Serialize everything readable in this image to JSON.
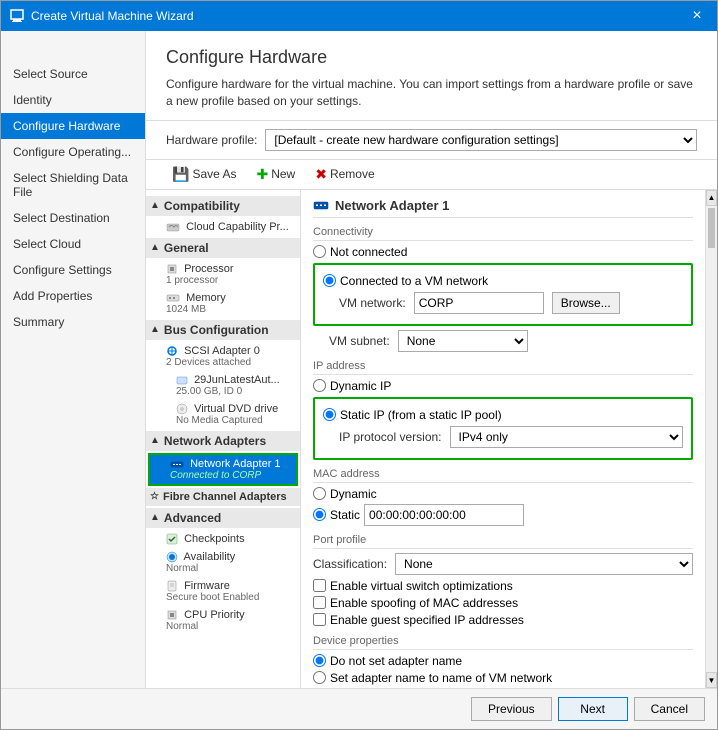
{
  "window": {
    "title": "Create Virtual Machine Wizard",
    "close_icon": "×"
  },
  "left_panel": {
    "header": "Configure Hardware",
    "nav_items": [
      {
        "label": "Select Source",
        "active": false
      },
      {
        "label": "Identity",
        "active": false
      },
      {
        "label": "Configure Hardware",
        "active": true
      },
      {
        "label": "Configure Operating...",
        "active": false
      },
      {
        "label": "Select Shielding Data File",
        "active": false
      },
      {
        "label": "Select Destination",
        "active": false
      },
      {
        "label": "Select Cloud",
        "active": false
      },
      {
        "label": "Configure Settings",
        "active": false
      },
      {
        "label": "Add Properties",
        "active": false
      },
      {
        "label": "Summary",
        "active": false
      }
    ]
  },
  "page": {
    "title": "Configure Hardware",
    "description": "Configure hardware for the virtual machine. You can import settings from a hardware profile or save a new profile based on your settings.",
    "hardware_profile_label": "Hardware profile:",
    "hardware_profile_value": "[Default - create new hardware configuration settings]"
  },
  "toolbar": {
    "save_as": "Save As",
    "new": "New",
    "remove": "Remove"
  },
  "tree": {
    "compatibility": {
      "label": "Compatibility",
      "items": [
        {
          "label": "Cloud Capability Pr...",
          "sub": ""
        }
      ]
    },
    "general": {
      "label": "General",
      "items": [
        {
          "label": "Processor",
          "sub": "1 processor"
        },
        {
          "label": "Memory",
          "sub": "1024 MB"
        }
      ]
    },
    "bus_configuration": {
      "label": "Bus Configuration",
      "items": [
        {
          "label": "SCSI Adapter 0",
          "sub": "2 Devices attached"
        },
        {
          "label": "29JunLatestAut...",
          "sub": "25.00 GB, ID 0"
        },
        {
          "label": "Virtual DVD drive",
          "sub": "No Media Captured"
        }
      ]
    },
    "network_adapters": {
      "label": "Network Adapters",
      "items": [
        {
          "label": "Network Adapter 1",
          "sub": "Connected to CORP",
          "selected": true
        }
      ]
    },
    "fibre_channel": {
      "label": "Fibre Channel Adapters"
    },
    "advanced": {
      "label": "Advanced",
      "items": [
        {
          "label": "Checkpoints",
          "sub": ""
        },
        {
          "label": "Availability",
          "sub": "Normal"
        },
        {
          "label": "Firmware",
          "sub": "Secure boot Enabled"
        },
        {
          "label": "CPU Priority",
          "sub": "Normal"
        }
      ]
    }
  },
  "network_adapter": {
    "title": "Network Adapter 1",
    "connectivity": {
      "section": "Connectivity",
      "not_connected": "Not connected",
      "connected_to_vm": "Connected to a VM network",
      "vm_network_label": "VM network:",
      "vm_network_value": "CORP",
      "browse_btn": "Browse...",
      "vm_subnet_label": "VM subnet:",
      "vm_subnet_value": "None"
    },
    "ip_address": {
      "section": "IP address",
      "dynamic_ip": "Dynamic IP",
      "static_ip": "Static IP (from a static IP pool)",
      "ip_protocol_label": "IP protocol version:",
      "ip_protocol_value": "IPv4 only"
    },
    "mac_address": {
      "section": "MAC address",
      "dynamic": "Dynamic",
      "static": "Static",
      "static_value": "00:00:00:00:00:00"
    },
    "port_profile": {
      "section": "Port profile",
      "classification_label": "Classification:",
      "classification_value": "None"
    },
    "checkboxes": [
      "Enable virtual switch optimizations",
      "Enable spoofing of MAC addresses",
      "Enable guest specified IP addresses"
    ],
    "device_properties": {
      "section": "Device properties",
      "do_not_set": "Do not set adapter name",
      "set_name": "Set adapter name to name of VM network"
    }
  },
  "footer": {
    "previous": "Previous",
    "next": "Next",
    "cancel": "Cancel"
  }
}
